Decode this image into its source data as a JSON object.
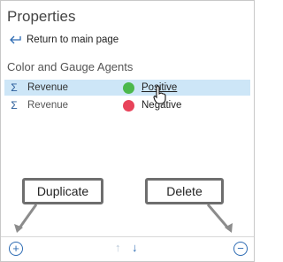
{
  "pane": {
    "title": "Properties",
    "back_label": "Return to main page",
    "section_title": "Color and Gauge Agents"
  },
  "rows": [
    {
      "icon": "sigma-icon",
      "name": "Revenue",
      "agent": "Positive",
      "color": "#4cb84c"
    },
    {
      "icon": "sigma-icon",
      "name": "Revenue",
      "agent": "Negative",
      "color": "#e8435a"
    }
  ],
  "callouts": {
    "duplicate": "Duplicate",
    "delete": "Delete"
  },
  "colors": {
    "selection": "#cde6f7",
    "accent": "#2d6bb3"
  }
}
